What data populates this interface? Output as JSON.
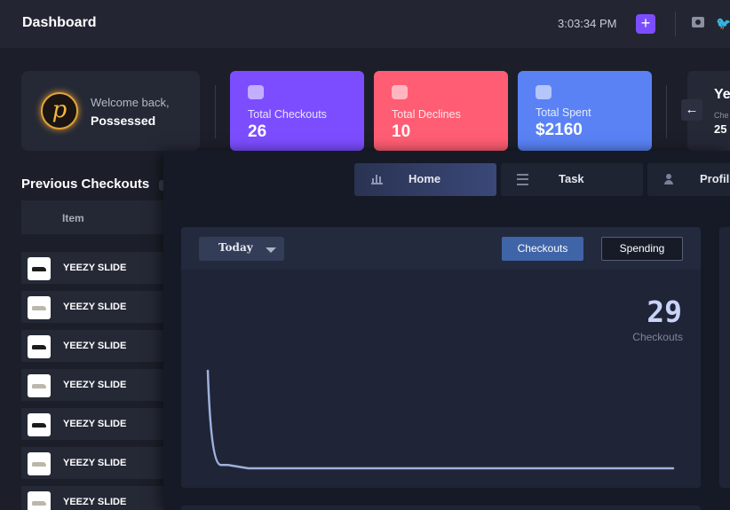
{
  "header": {
    "title": "Dashboard",
    "time": "3:03:34 PM",
    "add_label": "+",
    "icons": [
      "camera-icon",
      "twitter-icon"
    ]
  },
  "welcome": {
    "greeting": "Welcome back,",
    "name": "Possessed",
    "avatar_letter": "p"
  },
  "stats": [
    {
      "label": "Total Checkouts",
      "value": "26",
      "color": "#7c4dff"
    },
    {
      "label": "Total Declines",
      "value": "10",
      "color": "#ff5d73"
    },
    {
      "label": "Total Spent",
      "value": "$2160",
      "color": "#5a82f5"
    }
  ],
  "partial_card": {
    "title": "Ye",
    "subtitle": "Che",
    "value": "25"
  },
  "previous_checkouts": {
    "title": "Previous Checkouts",
    "column": "Item",
    "rows": [
      {
        "item": "YEEZY SLIDE",
        "shoe_color": "#1c1c1c"
      },
      {
        "item": "YEEZY SLIDE",
        "shoe_color": "#bdb7aa"
      },
      {
        "item": "YEEZY SLIDE",
        "shoe_color": "#1c1c1c"
      },
      {
        "item": "YEEZY SLIDE",
        "shoe_color": "#bdb7aa"
      },
      {
        "item": "YEEZY SLIDE",
        "shoe_color": "#1c1c1c"
      },
      {
        "item": "YEEZY SLIDE",
        "shoe_color": "#bdb7aa"
      },
      {
        "item": "YEEZY SLIDE",
        "shoe_color": "#bdb7aa"
      }
    ]
  },
  "nav": {
    "tabs": [
      {
        "label": "Home",
        "icon": "bar-chart-icon",
        "active": true
      },
      {
        "label": "Task",
        "icon": "list-icon",
        "active": false
      },
      {
        "label": "Profil",
        "icon": "profile-icon",
        "active": false
      }
    ]
  },
  "panel": {
    "range": "Today",
    "toggle_on": "Checkouts",
    "toggle_off": "Spending",
    "count": "29",
    "count_label": "Checkouts"
  },
  "chart_data": {
    "type": "line",
    "x": [
      0,
      1,
      2,
      3,
      4,
      5,
      6,
      7,
      8,
      9,
      10,
      11,
      12,
      13,
      14,
      15,
      16,
      17,
      18,
      19,
      20,
      21,
      22,
      23
    ],
    "series": [
      {
        "values": [
          29,
          1,
          0,
          0,
          0,
          0,
          0,
          0,
          0,
          0,
          0,
          0,
          0,
          0,
          0,
          0,
          0,
          0,
          0,
          0,
          0,
          0,
          0,
          0
        ]
      }
    ],
    "ylim": [
      0,
      29
    ],
    "grid": false,
    "line_color": "#9fb0de"
  }
}
